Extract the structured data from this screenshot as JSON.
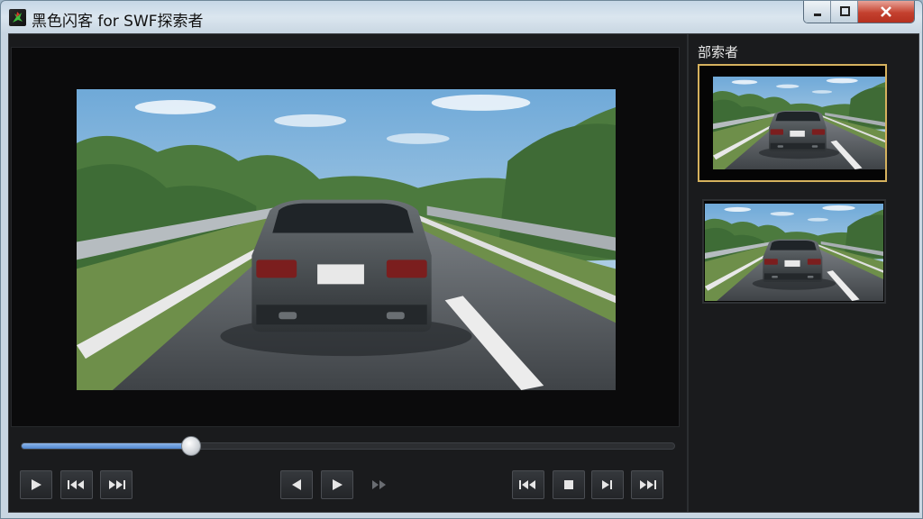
{
  "window": {
    "title": "黑色闪客 for SWF探索者",
    "controls": [
      "minimize",
      "maximize",
      "close"
    ]
  },
  "sidebar": {
    "title": "部索者",
    "thumbnails": [
      {
        "name": "thumbnail-1",
        "selected": true
      },
      {
        "name": "thumbnail-2",
        "selected": false
      }
    ]
  },
  "playback": {
    "progress": 0.26
  },
  "controls": {
    "left": [
      "play-icon",
      "rewind-icon",
      "fast-forward-icon"
    ],
    "center": [
      "previous-frame-icon",
      "play-icon",
      "next-frame-icon-disabled"
    ],
    "right": [
      "skip-to-start-icon",
      "stop-icon",
      "step-forward-icon",
      "skip-to-end-icon"
    ]
  },
  "colors": {
    "accent": "#4f86cf",
    "selection_border": "#d6b25e",
    "close_button": "#c4412f"
  }
}
